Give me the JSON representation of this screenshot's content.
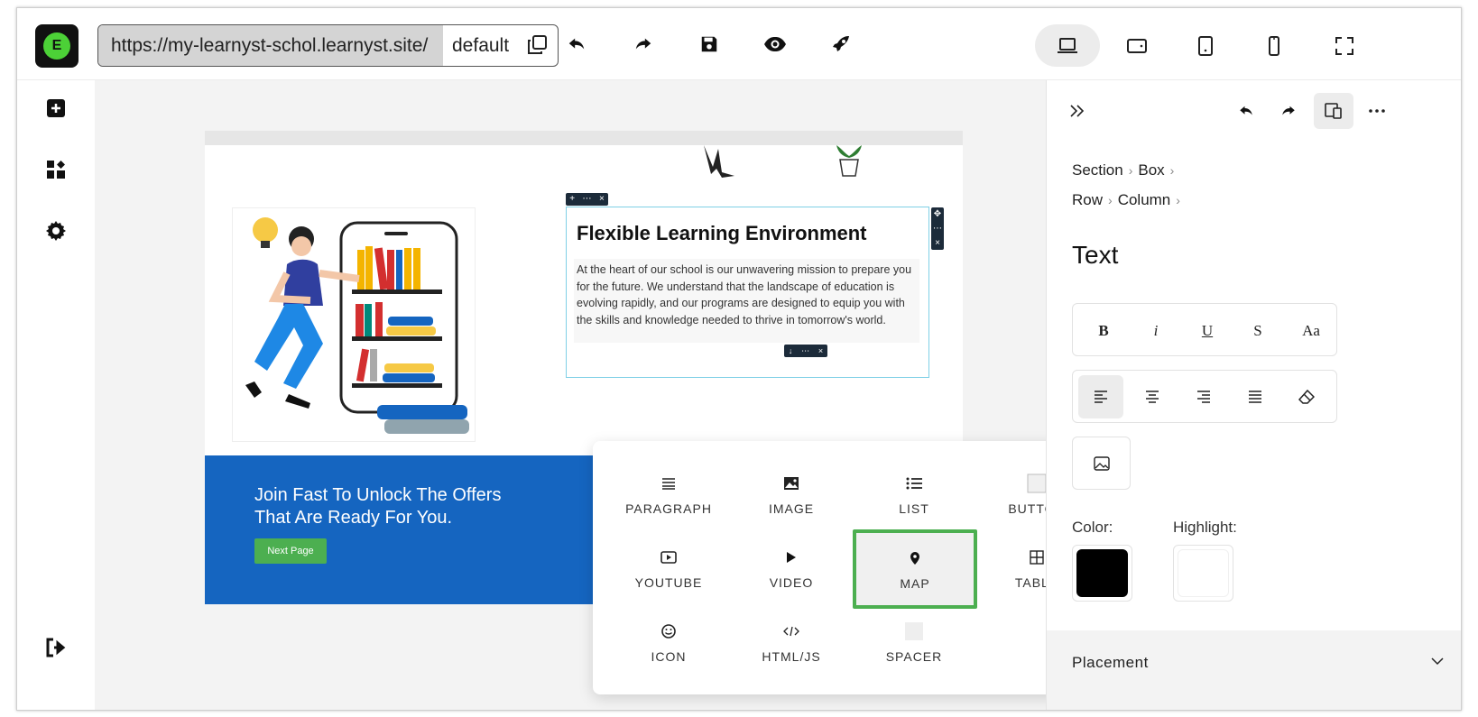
{
  "toolbar": {
    "logo_letter": "E",
    "url": "https://my-learnyst-schol.learnyst.site/",
    "mode": "default"
  },
  "page": {
    "heading": "Flexible Learning Environment",
    "paragraph": "At the heart of our school is our unwavering mission to prepare you for the future. We understand that the landscape of education is evolving rapidly, and our programs are designed to equip you with the skills and knowledge needed to thrive in tomorrow's world.",
    "banner_headline": "Join Fast To Unlock The Offers That Are Ready For You.",
    "banner_button": "Next Page"
  },
  "picker": {
    "items": [
      {
        "label": "PARAGRAPH",
        "icon": "paragraph-icon"
      },
      {
        "label": "IMAGE",
        "icon": "image-icon"
      },
      {
        "label": "LIST",
        "icon": "list-icon"
      },
      {
        "label": "BUTTON",
        "icon": "button-icon"
      },
      {
        "label": "YOUTUBE",
        "icon": "youtube-icon"
      },
      {
        "label": "VIDEO",
        "icon": "video-icon"
      },
      {
        "label": "MAP",
        "icon": "map-pin-icon"
      },
      {
        "label": "TABLE",
        "icon": "table-icon"
      },
      {
        "label": "ICON",
        "icon": "smiley-icon"
      },
      {
        "label": "HTML/JS",
        "icon": "code-icon"
      },
      {
        "label": "SPACER",
        "icon": "spacer-icon"
      }
    ],
    "selected": "MAP",
    "selected_color": "#4caf50"
  },
  "panel": {
    "breadcrumb_1": [
      "Section",
      "Box"
    ],
    "breadcrumb_2": [
      "Row",
      "Column"
    ],
    "title": "Text",
    "format": {
      "bold": "B",
      "italic": "i",
      "underline": "U",
      "strike": "S",
      "case": "Aa"
    },
    "color_label": "Color:",
    "highlight_label": "Highlight:",
    "color_value": "#000000",
    "highlight_value": "#ffffff",
    "placement_label": "Placement"
  },
  "colors": {
    "banner": "#1565c0",
    "logo_accent": "#4cd137",
    "button_green": "#4caf50"
  }
}
